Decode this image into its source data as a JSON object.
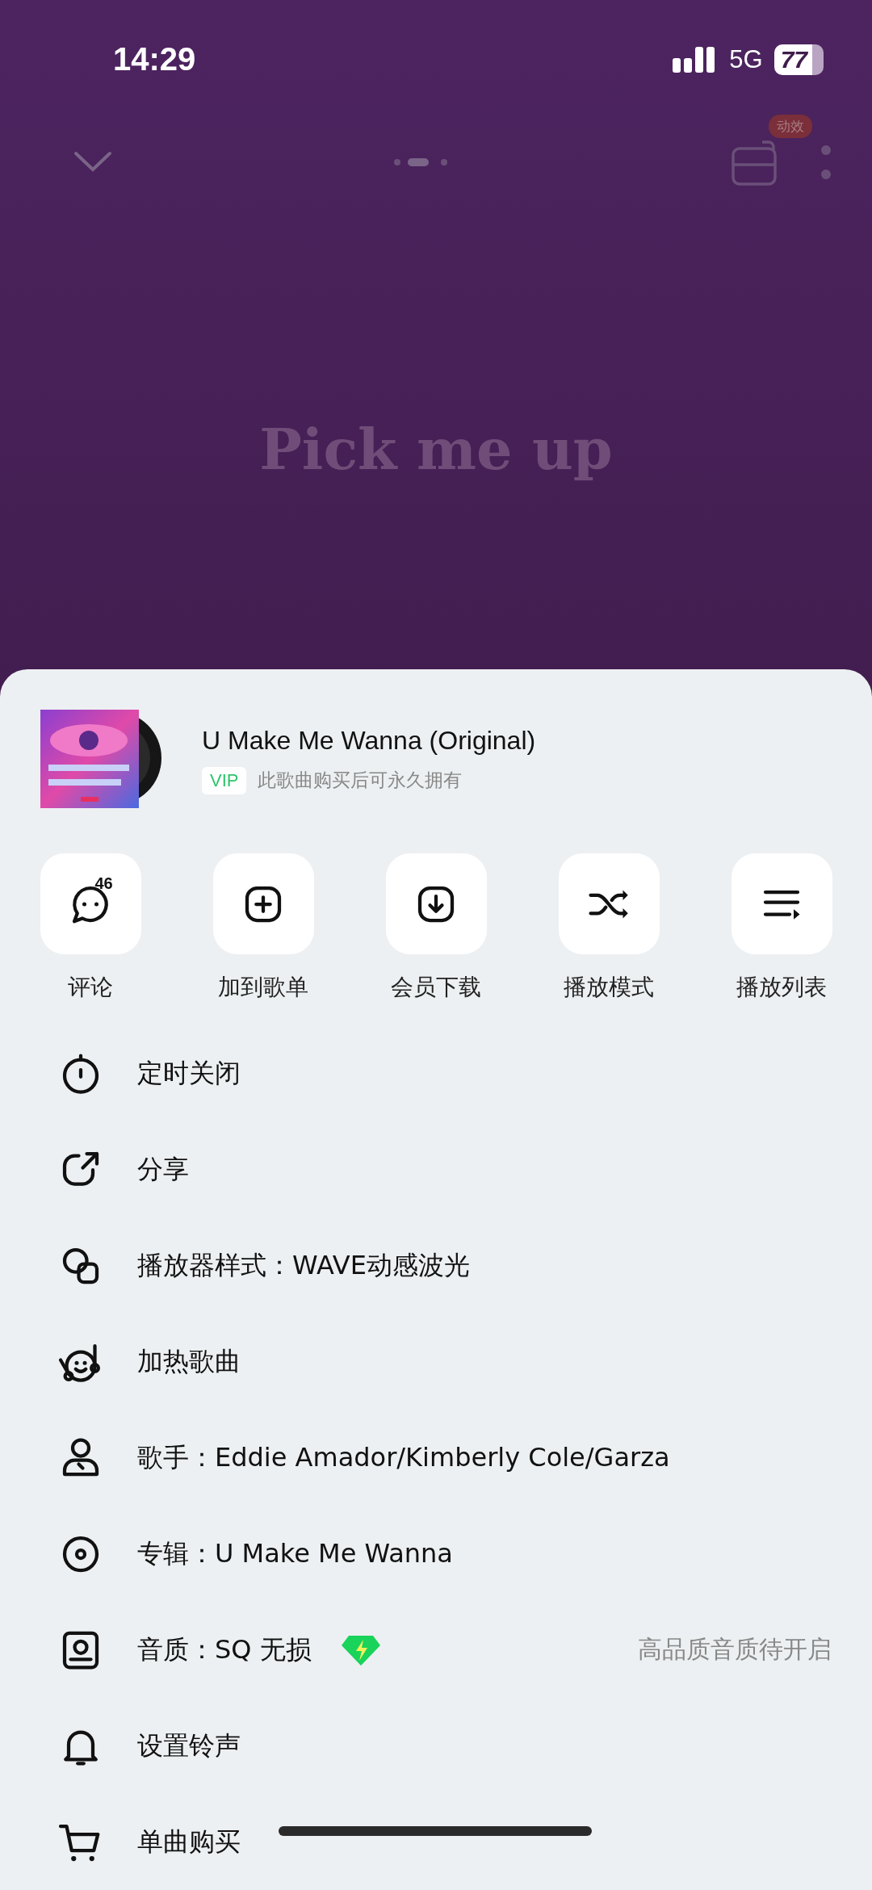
{
  "status_bar": {
    "time": "14:29",
    "network": "5G",
    "battery": "77"
  },
  "top_bar": {
    "effect_tag": "动效"
  },
  "lyric": "Pick me up",
  "song": {
    "title": "U Make Me Wanna (Original)",
    "vip_tag": "VIP",
    "note": "此歌曲购买后可永久拥有"
  },
  "actions": [
    {
      "kind": "comment",
      "label": "评论",
      "count": "46"
    },
    {
      "kind": "add",
      "label": "加到歌单"
    },
    {
      "kind": "download",
      "label": "会员下载"
    },
    {
      "kind": "shuffle",
      "label": "播放模式"
    },
    {
      "kind": "playlist",
      "label": "播放列表"
    }
  ],
  "menu": [
    {
      "kind": "timer",
      "label": "定时关闭"
    },
    {
      "kind": "share",
      "label": "分享"
    },
    {
      "kind": "style",
      "label": "播放器样式：WAVE动感波光"
    },
    {
      "kind": "hot",
      "label": "加热歌曲"
    },
    {
      "kind": "singer",
      "label": "歌手：Eddie Amador/Kimberly Cole/Garza"
    },
    {
      "kind": "album",
      "label": "专辑：U Make Me Wanna"
    },
    {
      "kind": "quality",
      "label": "音质：SQ 无损",
      "hint": "高品质音质待开启"
    },
    {
      "kind": "ringtone",
      "label": "设置铃声"
    },
    {
      "kind": "buy",
      "label": "单曲购买"
    }
  ]
}
